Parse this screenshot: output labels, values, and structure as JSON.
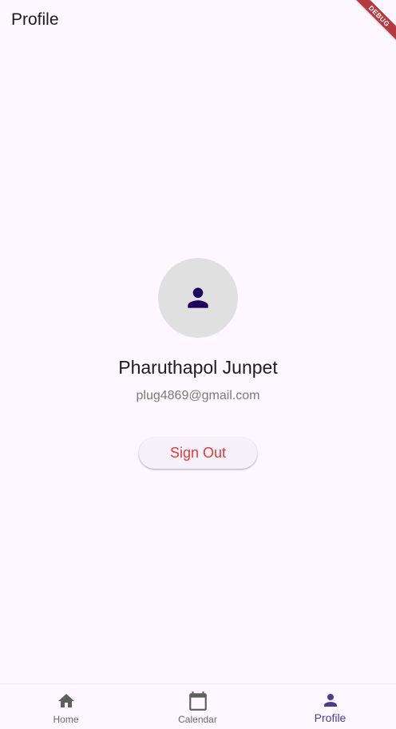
{
  "app_bar": {
    "title": "Profile"
  },
  "debug_banner": {
    "label": "DEBUG"
  },
  "profile": {
    "avatar_icon": "person-icon",
    "name": "Pharuthapol Junpet",
    "email": "plug4869@gmail.com",
    "sign_out_label": "Sign Out"
  },
  "bottom_nav": {
    "selected": "Profile",
    "items": [
      {
        "label": "Home",
        "icon": "home-icon"
      },
      {
        "label": "Calendar",
        "icon": "calendar-icon"
      },
      {
        "label": "Profile",
        "icon": "person-icon"
      }
    ]
  },
  "colors": {
    "background": "#fdf7ff",
    "avatar_bg": "#e0e0e0",
    "avatar_icon": "#21005d",
    "sign_out_text": "#e53935",
    "nav_selected": "#4a3d8f",
    "nav_unselected": "#6b6b6b",
    "debug_banner": "#b53a3f"
  }
}
